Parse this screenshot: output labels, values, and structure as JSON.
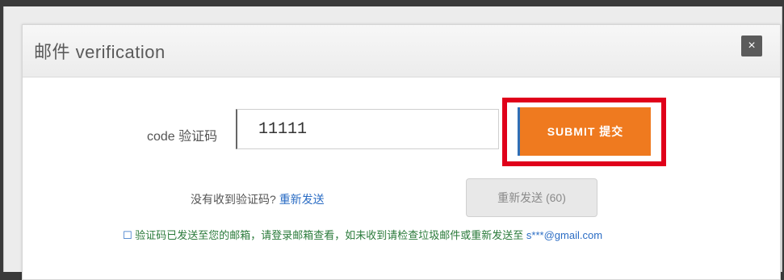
{
  "dialog": {
    "title": "邮件 verification",
    "close_icon": "×"
  },
  "form": {
    "label": "code 验证码",
    "code_value": "11111",
    "submit_label": "SUBMIT 提交"
  },
  "resend": {
    "text": "没有收到验证码?",
    "link": "重新发送",
    "button_label": "重新发送 (60)"
  },
  "hint": {
    "icon": "☐",
    "text": "验证码已发送至您的邮箱，请登录邮箱查看，如未收到请检查垃圾邮件或重新发送至",
    "email": "s***@gmail.com"
  },
  "colors": {
    "accent": "#ef7a1f",
    "highlight": "#e0001a",
    "link": "#2a6cc4"
  }
}
